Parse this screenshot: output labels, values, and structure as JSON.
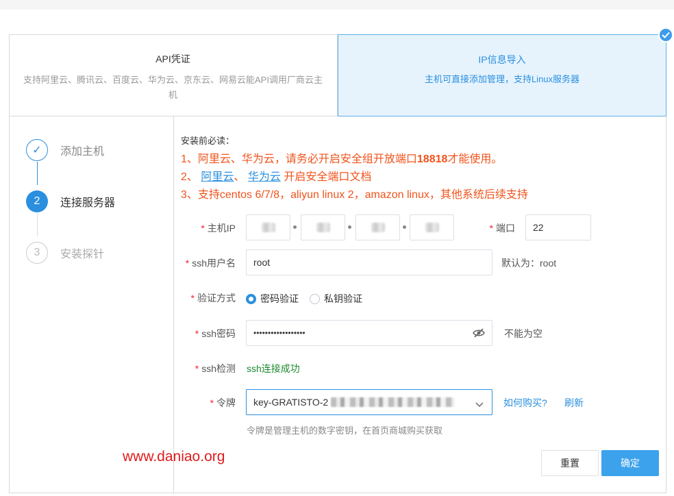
{
  "tabs": {
    "api": {
      "title": "API凭证",
      "desc": "支持阿里云、腾讯云、百度云、华为云、京东云、网易云能API调用厂商云主机"
    },
    "ip": {
      "title": "IP信息导入",
      "desc": "主机可直接添加管理，支持Linux服务器"
    }
  },
  "steps": [
    {
      "num": "✓",
      "label": "添加主机",
      "state": "done"
    },
    {
      "num": "2",
      "label": "连接服务器",
      "state": "active"
    },
    {
      "num": "3",
      "label": "安装探针",
      "state": "wait"
    }
  ],
  "notice": {
    "title": "安装前必读：",
    "line1_prefix": "1、阿里云、华为云，请务必开启安全组开放端口",
    "line1_port": "18818",
    "line1_suffix": "才能使用。",
    "line2_prefix": "2、",
    "line2_link1": "阿里云",
    "line2_sep": "、",
    "line2_link2": "华为云",
    "line2_suffix": "开启安全端口文档",
    "line3": "3、支持centos 6/7/8，aliyun linux 2，amazon linux，其他系统后续支持"
  },
  "form": {
    "host_ip_label": "主机IP",
    "port_label": "端口",
    "port_value": "22",
    "ssh_user_label": "ssh用户名",
    "ssh_user_value": "root",
    "ssh_user_hint": "默认为：root",
    "auth_label": "验证方式",
    "auth_options": [
      "密码验证",
      "私钥验证"
    ],
    "auth_selected": "密码验证",
    "ssh_pass_label": "ssh密码",
    "ssh_pass_value": "••••••••••••••••••",
    "ssh_pass_hint": "不能为空",
    "ssh_check_label": "ssh检测",
    "ssh_check_value": "ssh连接成功",
    "token_label": "令牌",
    "token_value": "key-GRATISTO-2",
    "token_buy_link": "如何购买?",
    "token_refresh_link": "刷新",
    "token_help": "令牌是管理主机的数字密钥，在首页商城购买获取"
  },
  "buttons": {
    "reset": "重置",
    "confirm": "确定"
  },
  "watermark": "www.daniao.org",
  "colors": {
    "accent": "#2a8fde",
    "warning": "#f0531c",
    "success": "#1d8a2f",
    "required": "#f5222d"
  }
}
